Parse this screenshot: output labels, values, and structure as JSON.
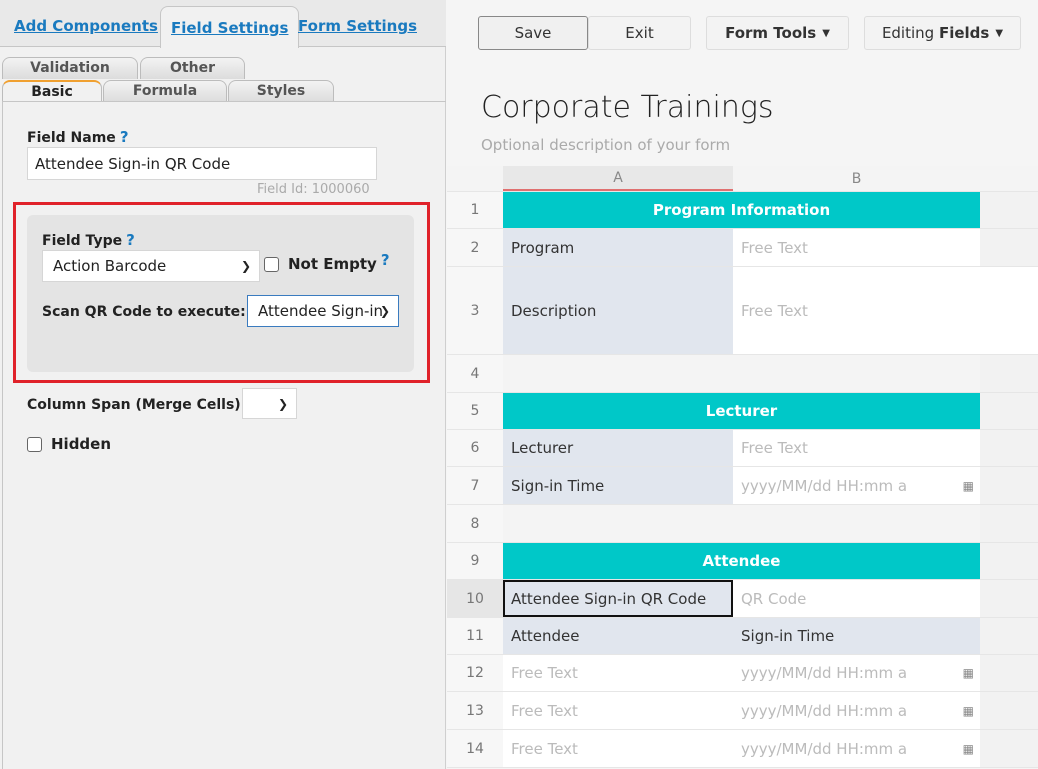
{
  "left": {
    "top_tabs": [
      "Add Components",
      "Field Settings",
      "Form Settings"
    ],
    "sub_tabs_back": [
      "Validation",
      "Other"
    ],
    "sub_tabs_front": [
      "Basic",
      "Formula",
      "Styles"
    ],
    "field_name_label": "Field Name",
    "field_name_value": "Attendee Sign-in QR Code",
    "field_id": "Field Id: 1000060",
    "field_type_label": "Field Type",
    "field_type_value": "Action Barcode",
    "not_empty_label": "Not Empty",
    "scan_label": "Scan QR Code to execute:",
    "scan_value": "Attendee Sign-in",
    "column_span_label": "Column Span (Merge Cells)",
    "column_span_value": "",
    "hidden_label": "Hidden",
    "help": "?"
  },
  "toolbar": {
    "save": "Save",
    "exit": "Exit",
    "form_tools": "Form Tools",
    "editing_prefix": "Editing",
    "editing_mode": "Fields"
  },
  "form": {
    "title": "Corporate Trainings",
    "description": "Optional description of your form"
  },
  "grid": {
    "columns": [
      "A",
      "B"
    ],
    "rows": [
      {
        "n": "1",
        "type": "header",
        "text": "Program Information"
      },
      {
        "n": "2",
        "a": "Program",
        "b": "Free Text"
      },
      {
        "n": "3",
        "a": "Description",
        "b": "Free Text",
        "wide": true
      },
      {
        "n": "4",
        "type": "empty"
      },
      {
        "n": "5",
        "type": "header",
        "text": "Lecturer"
      },
      {
        "n": "6",
        "a": "Lecturer",
        "b": "Free Text"
      },
      {
        "n": "7",
        "a": "Sign-in Time",
        "b": "yyyy/MM/dd HH:mm a",
        "cal": true
      },
      {
        "n": "8",
        "type": "empty"
      },
      {
        "n": "9",
        "type": "header",
        "text": "Attendee"
      },
      {
        "n": "10",
        "a": "Attendee Sign-in QR Code",
        "b": "QR Code",
        "selected": true
      },
      {
        "n": "11",
        "a": "Attendee",
        "b": "Sign-in Time",
        "blabel": true
      },
      {
        "n": "12",
        "a": "Free Text",
        "b": "yyyy/MM/dd HH:mm a",
        "cal": true,
        "aval": true
      },
      {
        "n": "13",
        "a": "Free Text",
        "b": "yyyy/MM/dd HH:mm a",
        "cal": true,
        "aval": true
      },
      {
        "n": "14",
        "a": "Free Text",
        "b": "yyyy/MM/dd HH:mm a",
        "cal": true,
        "aval": true
      }
    ]
  },
  "colors": {
    "accent": "#00c8c8",
    "link": "#1a7abf",
    "highlight": "#e0222a"
  }
}
